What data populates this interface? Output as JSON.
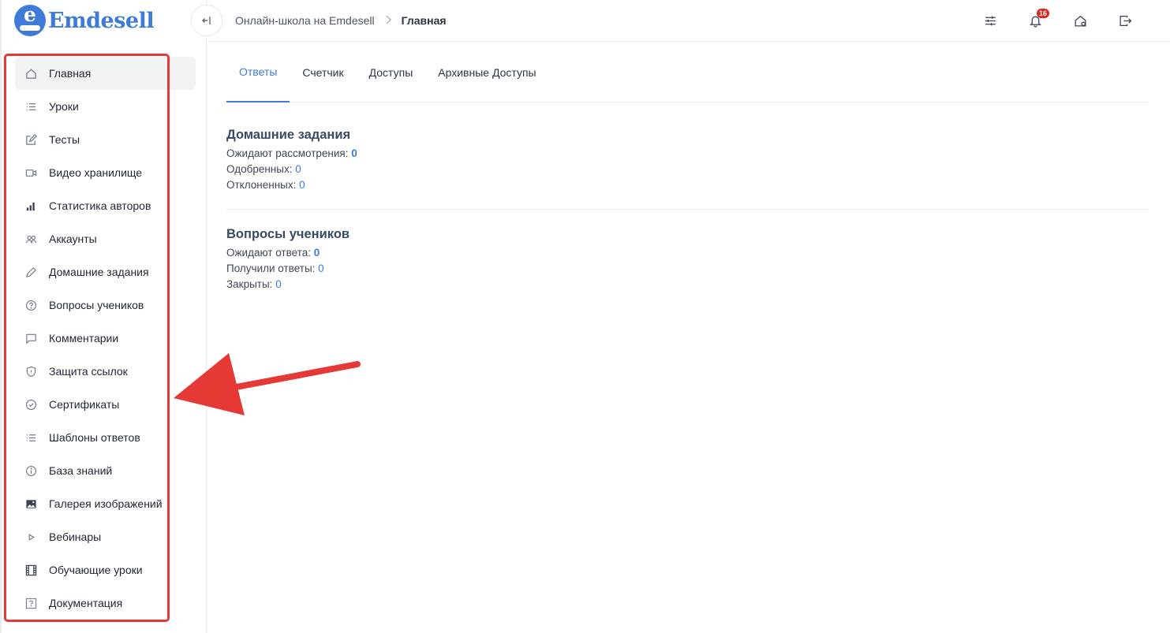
{
  "brand": {
    "name": "Emdesell",
    "letter": "e",
    "color": "#3e7bd8"
  },
  "breadcrumb": {
    "root": "Онлайн-школа на Emdesell",
    "current": "Главная"
  },
  "header": {
    "notifications_count": "16"
  },
  "sidebar": {
    "items": [
      {
        "label": "Главная",
        "icon": "home-icon"
      },
      {
        "label": "Уроки",
        "icon": "list-icon"
      },
      {
        "label": "Тесты",
        "icon": "edit-icon"
      },
      {
        "label": "Видео хранилище",
        "icon": "video-icon"
      },
      {
        "label": "Статистика авторов",
        "icon": "bar-chart-icon"
      },
      {
        "label": "Аккаунты",
        "icon": "users-icon"
      },
      {
        "label": "Домашние задания",
        "icon": "pencil-icon"
      },
      {
        "label": "Вопросы учеников",
        "icon": "help-circle-icon"
      },
      {
        "label": "Комментарии",
        "icon": "comment-icon"
      },
      {
        "label": "Защита ссылок",
        "icon": "shield-icon"
      },
      {
        "label": "Сертификаты",
        "icon": "check-circle-icon"
      },
      {
        "label": "Шаблоны ответов",
        "icon": "list-icon"
      },
      {
        "label": "База знаний",
        "icon": "info-icon"
      },
      {
        "label": "Галерея изображений",
        "icon": "image-icon"
      },
      {
        "label": "Вебинары",
        "icon": "play-icon"
      },
      {
        "label": "Обучающие уроки",
        "icon": "film-icon"
      },
      {
        "label": "Документация",
        "icon": "question-square-icon"
      }
    ]
  },
  "tabs": [
    {
      "label": "Ответы"
    },
    {
      "label": "Счетчик"
    },
    {
      "label": "Доступы"
    },
    {
      "label": "Архивные Доступы"
    }
  ],
  "homework": {
    "title": "Домашние задания",
    "pending_label": "Ожидают рассмотрения:",
    "pending_value": "0",
    "approved_label": "Одобренных:",
    "approved_value": "0",
    "rejected_label": "Отклоненных:",
    "rejected_value": "0"
  },
  "questions": {
    "title": "Вопросы учеников",
    "waiting_label": "Ожидают ответа:",
    "waiting_value": "0",
    "answered_label": "Получили ответы:",
    "answered_value": "0",
    "closed_label": "Закрыты:",
    "closed_value": "0"
  },
  "annotation": {
    "color": "#e53935"
  }
}
